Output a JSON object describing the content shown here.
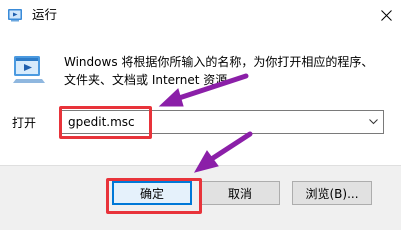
{
  "window": {
    "title": "运行",
    "app_icon": "run-icon",
    "close_icon": "close-icon"
  },
  "dialog": {
    "icon": "run-dialog-icon",
    "description": "Windows 将根据你所输入的名称，为你打开相应的程序、文件夹、文档或 Internet 资源",
    "open_label": "打开",
    "open_value": "gpedit.msc",
    "dropdown_icon": "chevron-down-icon"
  },
  "buttons": {
    "ok": "确定",
    "cancel": "取消",
    "browse": "浏览(B)..."
  },
  "annotations": {
    "highlight_color": "#e8333a",
    "arrow_color": "#8b1fa8"
  }
}
